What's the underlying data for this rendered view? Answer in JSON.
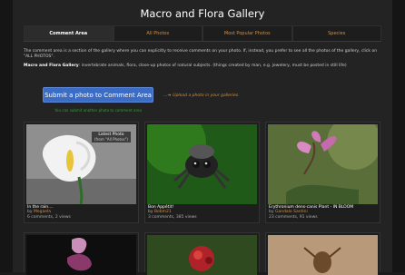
{
  "page": {
    "title": "Macro and Flora Gallery"
  },
  "tabs": [
    {
      "label": "Comment Area",
      "active": true
    },
    {
      "label": "All Photos",
      "active": false
    },
    {
      "label": "Most Popular Photos",
      "active": false
    },
    {
      "label": "Species",
      "active": false
    }
  ],
  "description": {
    "line1": "The comment area is a section of the gallery where you can explicitly to receive comments on your photo. If, instead, you prefer to see all the photos of the gallery, click on \"ALL PHOTOS\".",
    "line2_bold": "Macro and Flora Gallery",
    "line2": ": invertebrate animals, flora, close-up photos of natural subjects. (things created by man, e.g. jewelery, must be posted in still life)"
  },
  "actions": {
    "submit_label": "Submit a photo to Comment Area",
    "upload_link": "Upload a photo in your galleries.",
    "hint": "You can submit another photo to comment area"
  },
  "photos": [
    {
      "name": "In the rain....",
      "by_prefix": "by",
      "user": "Megaela",
      "stats": "6 comments, 2 views",
      "badge": "Latest Photo",
      "badge_sub": "(from \"All Photos\")"
    },
    {
      "name": "Bon Appétit!",
      "by_prefix": "by",
      "user": "Bobm21",
      "stats": "3 comments, 385 views",
      "badge": "",
      "badge_sub": ""
    },
    {
      "name": "Erythronium dens-canis Plant - IN BLOOM",
      "by_prefix": "by",
      "user": "Gandalo Santini",
      "stats": "23 comments, 91 views",
      "badge": "",
      "badge_sub": ""
    }
  ]
}
